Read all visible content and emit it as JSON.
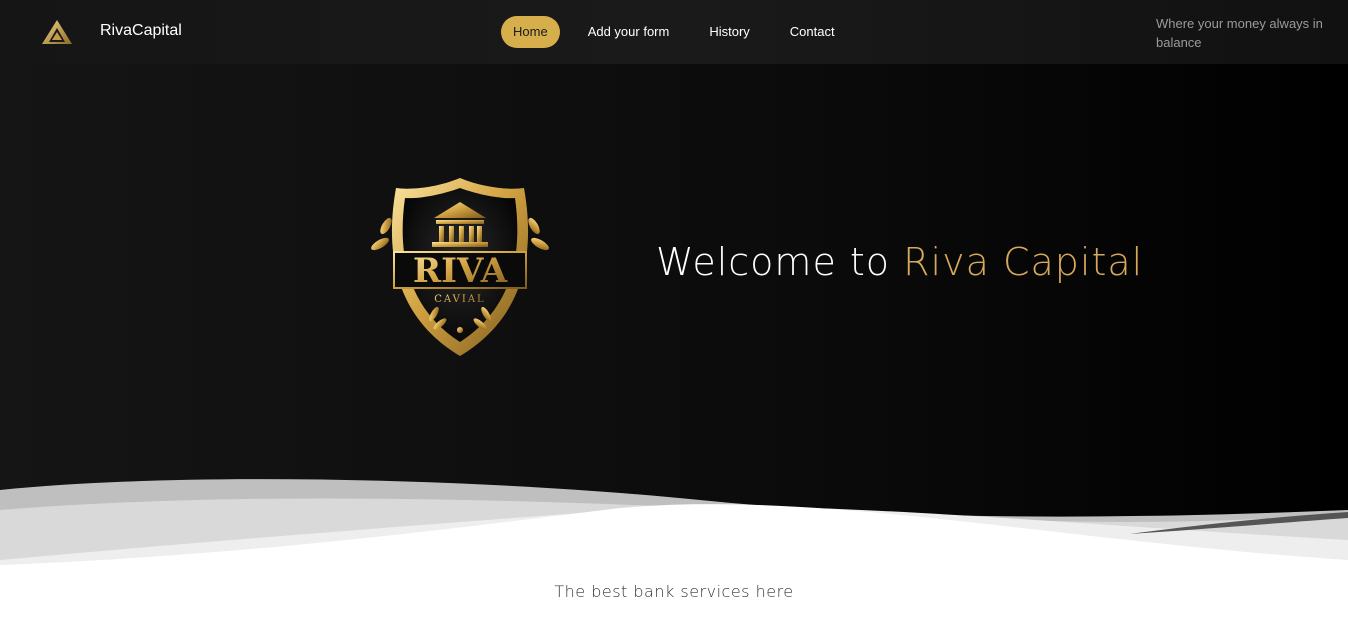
{
  "brand": {
    "name": "RivaCapital",
    "logo_icon": "pyramid-logo-icon"
  },
  "nav": {
    "items": [
      {
        "label": "Home",
        "active": true
      },
      {
        "label": "Add your form",
        "active": false
      },
      {
        "label": "History",
        "active": false
      },
      {
        "label": "Contact",
        "active": false
      }
    ]
  },
  "tagline": "Where your money always in balance",
  "hero": {
    "headline_prefix": "Welcome to",
    "headline_brand": "Riva Capital",
    "emblem": {
      "word": "RIVA",
      "subword": "CAVIAL",
      "icon": "shield-emblem-icon"
    }
  },
  "subtext": "The best bank services here",
  "colors": {
    "accent": "#d7ae4c",
    "hero_bg": "#0b0b0b",
    "gold_text": "#d7a95a"
  }
}
